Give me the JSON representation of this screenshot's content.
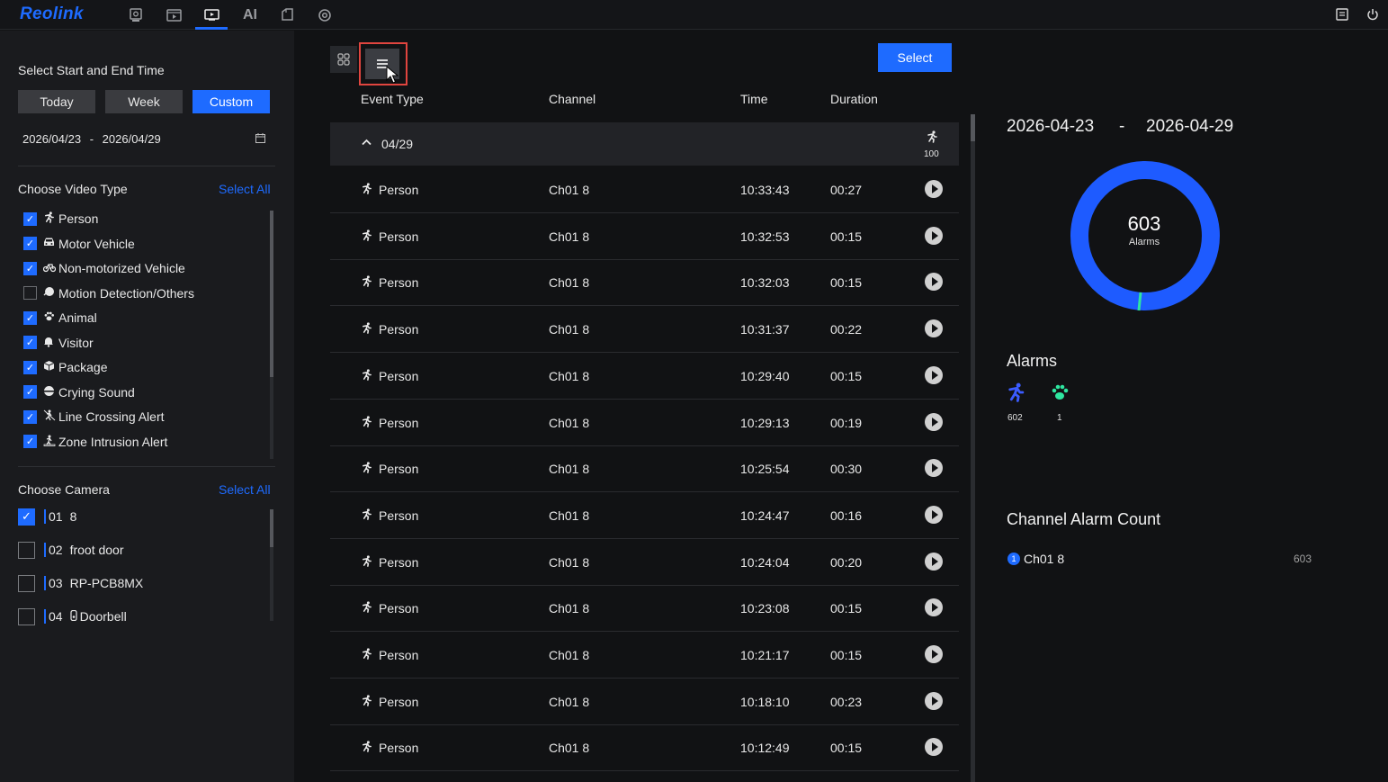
{
  "app": {
    "logo": "Reolink"
  },
  "nav": {
    "ai_label": "AI",
    "icons": [
      "live-view-icon",
      "playback-icon",
      "alarm-events-icon",
      "ai-icon",
      "clips-icon",
      "settings-icon"
    ],
    "right_icons": [
      "messages-icon",
      "power-icon"
    ]
  },
  "sidebar": {
    "time_title": "Select Start and End Time",
    "segments": [
      "Today",
      "Week",
      "Custom"
    ],
    "active_segment": "Custom",
    "date_start": "2026/04/23",
    "date_sep": "-",
    "date_end": "2026/04/29",
    "video_type_title": "Choose Video Type",
    "select_all": "Select All",
    "video_types": [
      {
        "label": "Person",
        "checked": true,
        "icon": "person-icon"
      },
      {
        "label": "Motor Vehicle",
        "checked": true,
        "icon": "car-icon"
      },
      {
        "label": "Non-motorized Vehicle",
        "checked": true,
        "icon": "bicycle-icon"
      },
      {
        "label": "Motion Detection/Others",
        "checked": false,
        "icon": "motion-icon"
      },
      {
        "label": "Animal",
        "checked": true,
        "icon": "paw-icon"
      },
      {
        "label": "Visitor",
        "checked": true,
        "icon": "bell-icon"
      },
      {
        "label": "Package",
        "checked": true,
        "icon": "package-icon"
      },
      {
        "label": "Crying Sound",
        "checked": true,
        "icon": "baby-icon"
      },
      {
        "label": "Line Crossing Alert",
        "checked": true,
        "icon": "line-crossing-icon"
      },
      {
        "label": "Zone Intrusion Alert",
        "checked": true,
        "icon": "zone-intrusion-icon"
      }
    ],
    "camera_title": "Choose Camera",
    "cameras": [
      {
        "num": "01",
        "name": "8",
        "checked": true
      },
      {
        "num": "02",
        "name": "froot door",
        "checked": false
      },
      {
        "num": "03",
        "name": "RP-PCB8MX",
        "checked": false
      },
      {
        "num": "04",
        "name": "Doorbell",
        "checked": false,
        "icon": "doorbell-icon"
      }
    ]
  },
  "main": {
    "select_label": "Select",
    "columns": {
      "event_type": "Event Type",
      "channel": "Channel",
      "time": "Time",
      "duration": "Duration"
    },
    "group": {
      "date": "04/29",
      "count": "100"
    },
    "events": [
      {
        "type": "Person",
        "channel": "Ch01 8",
        "time": "10:33:43",
        "duration": "00:27"
      },
      {
        "type": "Person",
        "channel": "Ch01 8",
        "time": "10:32:53",
        "duration": "00:15"
      },
      {
        "type": "Person",
        "channel": "Ch01 8",
        "time": "10:32:03",
        "duration": "00:15"
      },
      {
        "type": "Person",
        "channel": "Ch01 8",
        "time": "10:31:37",
        "duration": "00:22"
      },
      {
        "type": "Person",
        "channel": "Ch01 8",
        "time": "10:29:40",
        "duration": "00:15"
      },
      {
        "type": "Person",
        "channel": "Ch01 8",
        "time": "10:29:13",
        "duration": "00:19"
      },
      {
        "type": "Person",
        "channel": "Ch01 8",
        "time": "10:25:54",
        "duration": "00:30"
      },
      {
        "type": "Person",
        "channel": "Ch01 8",
        "time": "10:24:47",
        "duration": "00:16"
      },
      {
        "type": "Person",
        "channel": "Ch01 8",
        "time": "10:24:04",
        "duration": "00:20"
      },
      {
        "type": "Person",
        "channel": "Ch01 8",
        "time": "10:23:08",
        "duration": "00:15"
      },
      {
        "type": "Person",
        "channel": "Ch01 8",
        "time": "10:21:17",
        "duration": "00:15"
      },
      {
        "type": "Person",
        "channel": "Ch01 8",
        "time": "10:18:10",
        "duration": "00:23"
      },
      {
        "type": "Person",
        "channel": "Ch01 8",
        "time": "10:12:49",
        "duration": "00:15"
      }
    ]
  },
  "summary": {
    "date_start": "2026-04-23",
    "date_sep": "-",
    "date_end": "2026-04-29",
    "total": "603",
    "total_label": "Alarms",
    "alarms_title": "Alarms",
    "alarm_types": [
      {
        "icon": "person-icon",
        "count": "602",
        "color": "#3b5bff"
      },
      {
        "icon": "paw-icon",
        "count": "1",
        "color": "#2ee6a0"
      }
    ],
    "channel_title": "Channel Alarm Count",
    "channels": [
      {
        "badge": "1",
        "name": "Ch01 8",
        "count": "603"
      }
    ],
    "colors": {
      "person": "#1e5bff",
      "animal": "#2ee6a0"
    }
  }
}
